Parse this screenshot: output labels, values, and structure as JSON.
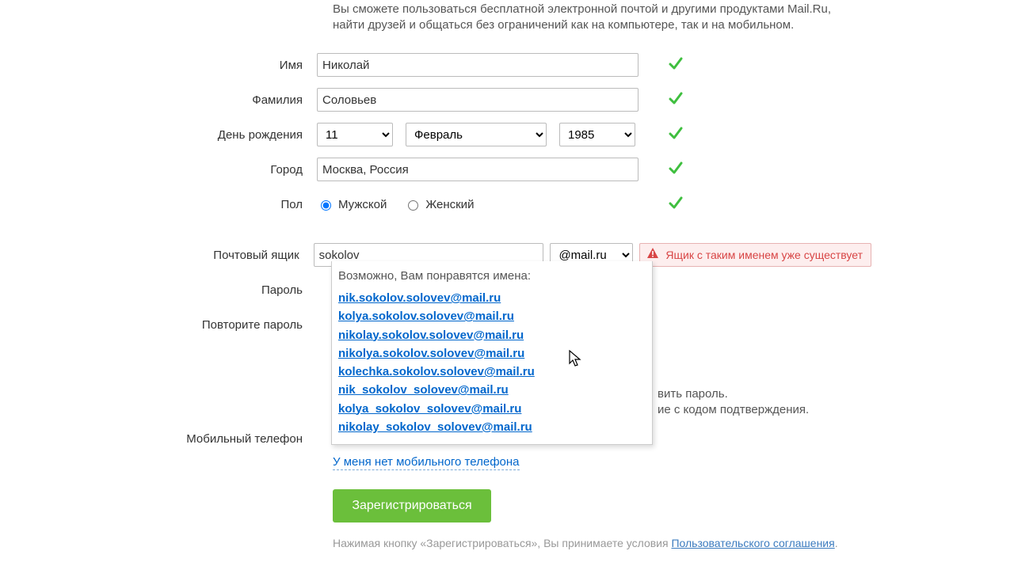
{
  "intro": "Вы сможете пользоваться бесплатной электронной почтой и другими продуктами Mail.Ru, найти друзей и общаться без ограничений как на компьютере, так и на мобильном.",
  "labels": {
    "first_name": "Имя",
    "last_name": "Фамилия",
    "birthday": "День рождения",
    "city": "Город",
    "gender": "Пол",
    "mailbox": "Почтовый ящик",
    "password": "Пароль",
    "password_repeat": "Повторите пароль",
    "mobile": "Мобильный телефон"
  },
  "values": {
    "first_name": "Николай",
    "last_name": "Соловьев",
    "day": "11",
    "month": "Февраль",
    "year": "1985",
    "city": "Москва, Россия",
    "mailbox_local": "sokolov",
    "mailbox_domain": "@mail.ru"
  },
  "gender": {
    "male": "Мужской",
    "female": "Женский"
  },
  "error": {
    "mailbox_taken": "Ящик с таким именем уже существует"
  },
  "suggest": {
    "title": "Возможно, Вам понравятся имена:",
    "items": [
      "nik.sokolov.solovev@mail.ru",
      "kolya.sokolov.solovev@mail.ru",
      "nikolay.sokolov.solovev@mail.ru",
      "nikolya.sokolov.solovev@mail.ru",
      "kolechka.sokolov.solovev@mail.ru",
      "nik_sokolov_solovev@mail.ru",
      "kolya_sokolov_solovev@mail.ru",
      "nikolay_sokolov_solovev@mail.ru"
    ]
  },
  "hidden_hint": {
    "line1_tail": "вить пароль.",
    "line2_tail": "ие с кодом подтверждения."
  },
  "no_phone": "У меня нет мобильного телефона",
  "submit": "Зарегистрироваться",
  "disclaimer_prefix": "Нажимая кнопку «Зарегистрироваться», Вы принимаете условия ",
  "disclaimer_link": "Пользовательского соглашения",
  "colors": {
    "accent": "#6bbf3b",
    "link": "#0066cc",
    "error": "#d84545"
  }
}
